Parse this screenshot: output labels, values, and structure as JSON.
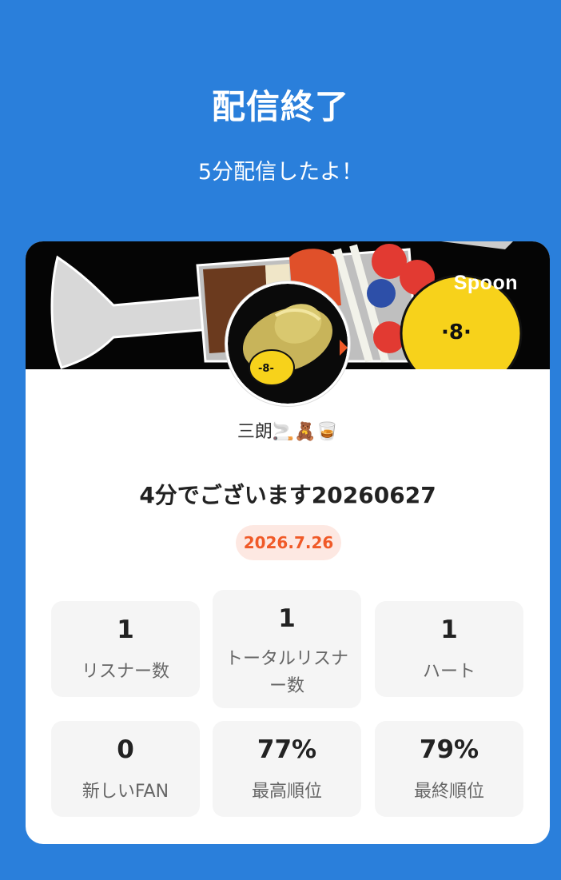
{
  "header": {
    "title": "配信終了",
    "subtitle": "5分配信したよ！"
  },
  "card": {
    "brand": "Spoon",
    "username": "三朗🚬🧸🥃",
    "broadcast_title": "4分でございます20260627",
    "date": "2026.7.26",
    "stats": [
      {
        "value": "1",
        "label": "リスナー数"
      },
      {
        "value": "1",
        "label": "トータルリスナー数"
      },
      {
        "value": "1",
        "label": "ハート"
      },
      {
        "value": "0",
        "label": "新しいFAN"
      },
      {
        "value": "77%",
        "label": "最高順位"
      },
      {
        "value": "79%",
        "label": "最終順位"
      }
    ]
  },
  "colors": {
    "background": "#2a7fdb",
    "badge_bg": "#fde8e2",
    "badge_text": "#f05a28",
    "stat_bg": "#f5f5f5"
  }
}
